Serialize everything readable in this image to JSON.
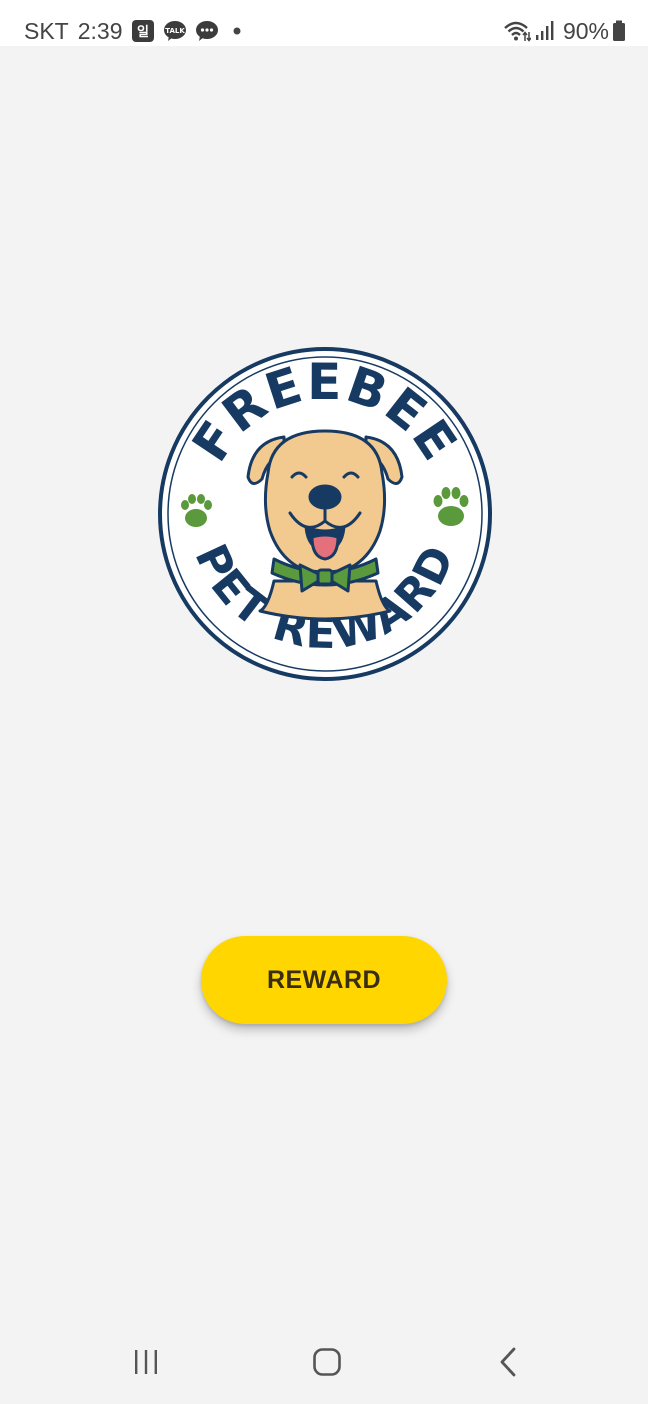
{
  "status_bar": {
    "carrier": "SKT",
    "time": "2:39",
    "notification_icons": [
      "naver-icon",
      "kakaotalk-icon",
      "message-icon",
      "dot-icon"
    ],
    "battery_percent": "90%",
    "status_icons": [
      "wifi-icon",
      "signal-icon",
      "battery-icon"
    ]
  },
  "logo": {
    "top_text": "FREEBEE",
    "bottom_text": "PET REWARD",
    "icons": [
      "dog-icon",
      "paw-icon"
    ]
  },
  "main": {
    "reward_button_label": "REWARD"
  },
  "nav_bar": {
    "buttons": [
      "recents-icon",
      "home-icon",
      "back-icon"
    ]
  },
  "colors": {
    "background": "#f3f3f3",
    "button_accent": "#ffd600",
    "logo_navy": "#173a63",
    "paw_green": "#5a9a3c",
    "dog_tan": "#f2c98e"
  }
}
